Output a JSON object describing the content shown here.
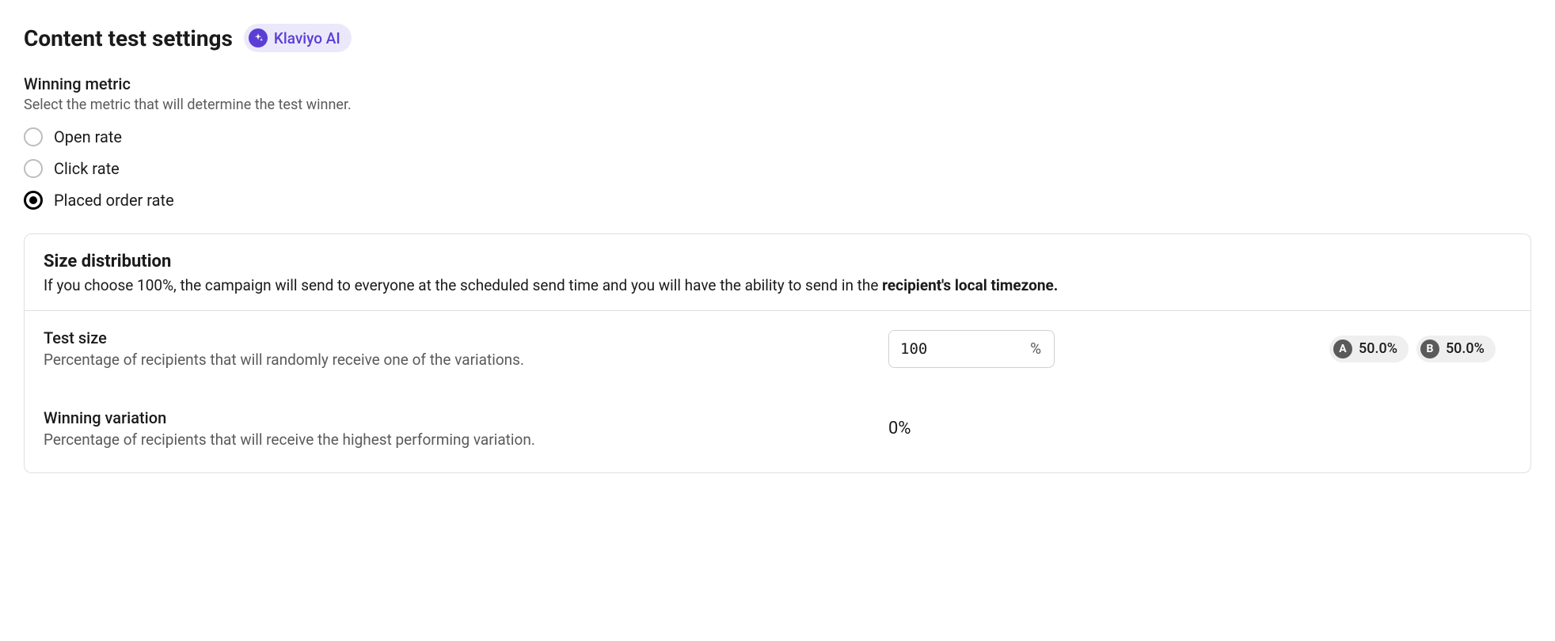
{
  "header": {
    "title": "Content test settings",
    "ai_badge": "Klaviyo AI"
  },
  "winning_metric": {
    "heading": "Winning metric",
    "subtext": "Select the metric that will determine the test winner.",
    "options": {
      "open_rate": "Open rate",
      "click_rate": "Click rate",
      "placed_order_rate": "Placed order rate"
    }
  },
  "size_distribution": {
    "title": "Size distribution",
    "desc_prefix": "If you choose 100%, the campaign will send to everyone at the scheduled send time and you will have the ability to send in the ",
    "desc_bold": "recipient's local timezone."
  },
  "test_size": {
    "title": "Test size",
    "subtext": "Percentage of recipients that will randomly receive one of the variations.",
    "value": "100",
    "suffix": "%",
    "variations": {
      "a_letter": "A",
      "a_pct": "50.0%",
      "b_letter": "B",
      "b_pct": "50.0%"
    }
  },
  "winning_variation": {
    "title": "Winning variation",
    "subtext": "Percentage of recipients that will receive the highest performing variation.",
    "value": "0%"
  }
}
